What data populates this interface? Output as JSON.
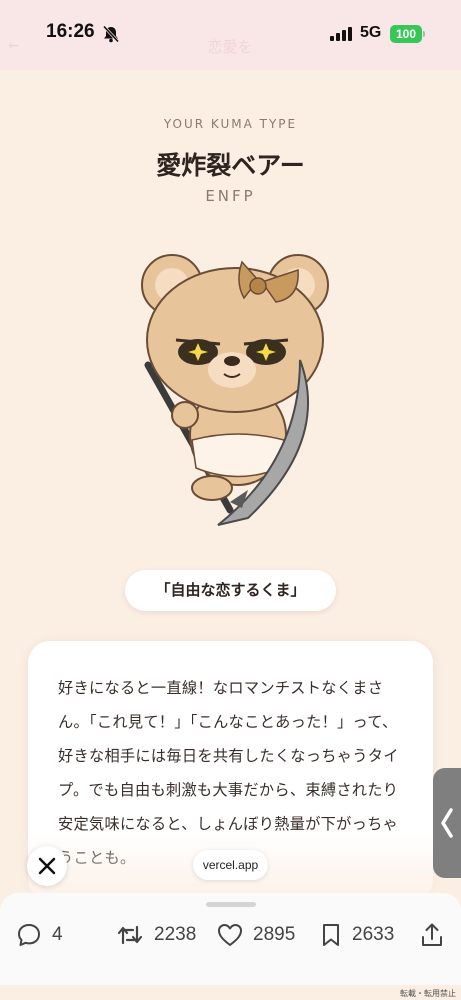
{
  "status_bar": {
    "time": "16:26",
    "network": "5G",
    "battery": "100",
    "ghost_title": "恋愛を",
    "ghost_back": "←"
  },
  "result": {
    "type_label": "YOUR KUMA TYPE",
    "type_name": "愛炸裂ベアー",
    "mbti": "ENFP",
    "catchphrase": "「自由な恋するくま」",
    "description": "好きになると一直線！なロマンチストなくまさん。「これ見て！」「こんなことあった！」って、好きな相手には毎日を共有したくなっちゃうタイプ。でも自由も刺激も大事だから、束縛されたり安定気味になると、しょんぼり熱量が下がっちゃうことも。"
  },
  "overlay": {
    "domain": "vercel.app",
    "close_icon": "close-icon",
    "side_handle_icon": "chevron-left-icon"
  },
  "actions": {
    "reply_count": "4",
    "repost_count": "2238",
    "like_count": "2895",
    "bookmark_count": "2633"
  },
  "footnote": "転載・転用禁止",
  "colors": {
    "background": "#fbeee3",
    "status_bar": "#f9e6e6",
    "battery": "#37c759",
    "bear_fur": "#e8c49a",
    "bow": "#c99a5e"
  }
}
